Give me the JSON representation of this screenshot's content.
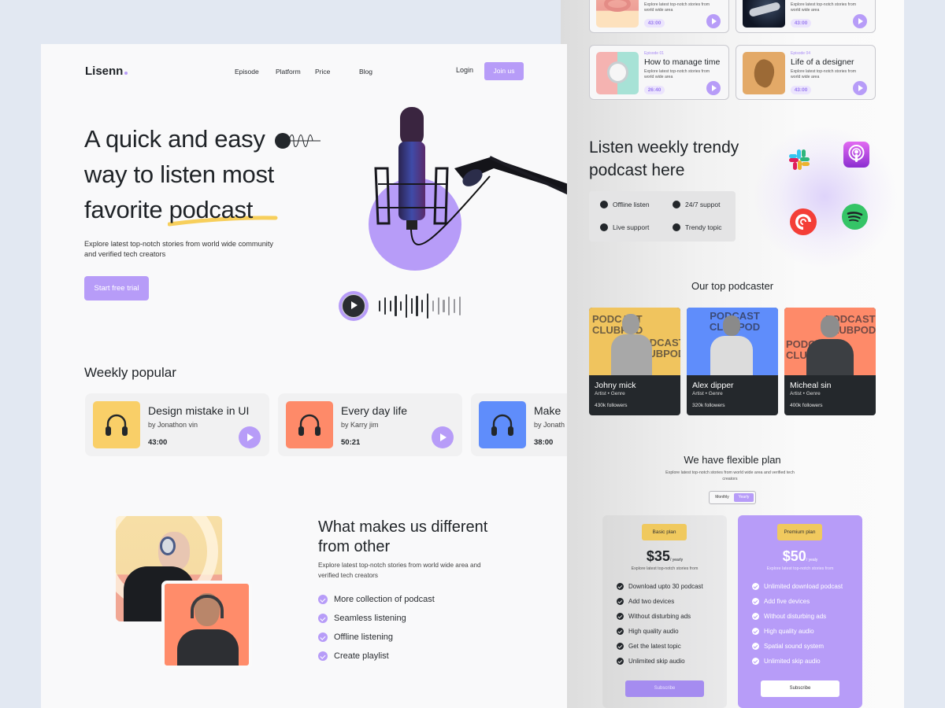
{
  "header": {
    "logo": "Lisenn",
    "nav": [
      "Episode",
      "Platform",
      "Price",
      "Blog"
    ],
    "login": "Login",
    "join": "Join us"
  },
  "hero": {
    "title_line1": "A quick and easy",
    "title_line2": "way to listen most",
    "title_line3_a": "favorite ",
    "title_line3_b": "podcast",
    "subtitle": "Explore latest top-notch stories from world wide community and verified tech creators",
    "cta": "Start free trial",
    "player": {
      "icon": "play-icon"
    }
  },
  "weekly": {
    "title": "Weekly popular",
    "items": [
      {
        "title": "Design mistake in UI",
        "author": "by Jonathon vin",
        "duration": "43:00",
        "color": "#f9cf68",
        "icon": "headphones-icon"
      },
      {
        "title": "Every day life",
        "author": "by Karry jim",
        "duration": "50:21",
        "color": "#fe8a69",
        "icon": "headphones-icon"
      },
      {
        "title": "Make",
        "author": "by Jonath",
        "duration": "38:00",
        "color": "#5f8dfb",
        "icon": "headphones-icon"
      }
    ]
  },
  "different": {
    "title": "What makes us different from other",
    "subtitle": "Explore latest top-notch stories from world wide area and verified tech creators",
    "features": [
      "More collection of podcast",
      "Seamless listening",
      "Offline listening",
      "Create playlist"
    ]
  },
  "episodes": [
    {
      "label": "",
      "title": "",
      "desc": "Explore latest top-notch stories from world wide area",
      "duration": "43:00"
    },
    {
      "label": "",
      "title": "",
      "desc": "Explore latest top-notch stories from world wide area",
      "duration": "43:00"
    },
    {
      "label": "Episode 01",
      "title": "How to manage time",
      "desc": "Explore latest top-notch stories from world wide area",
      "duration": "26:40"
    },
    {
      "label": "Episode 04",
      "title": "Life of a designer",
      "desc": "Explore latest top-notch stories from world wide area",
      "duration": "43:00"
    }
  ],
  "trendy": {
    "title": "Listen weekly trendy podcast here",
    "features": [
      "Offline listen",
      "24/7 suppot",
      "Live support",
      "Trendy topic"
    ],
    "apps": [
      "slack-icon",
      "apple-podcasts-icon",
      "pocket-casts-icon",
      "spotify-icon"
    ]
  },
  "podcasters": {
    "title": "Our top podcaster",
    "bg_text": "PODCAST CLUBPOD",
    "items": [
      {
        "name": "Johny mick",
        "meta": "Artist  •  Genre",
        "followers": "430k followers",
        "color": "#f0c45e"
      },
      {
        "name": "Alex dipper",
        "meta": "Artist  •  Genre",
        "followers": "320k followers",
        "color": "#5f8dfb"
      },
      {
        "name": "Micheal sin",
        "meta": "Artist  •  Genre",
        "followers": "400k followers",
        "color": "#fe8a69"
      }
    ]
  },
  "pricing": {
    "title": "We have flexible plan",
    "subtitle": "Explore latest top-notch stories from world wide area and verified tech creators",
    "toggle": {
      "monthly": "Monthly",
      "yearly": "Yearly",
      "selected": "Yearly"
    },
    "plans": [
      {
        "badge": "Basic plan",
        "price": "$35",
        "period": "/ yearly",
        "desc": "Explore latest top-notch stories from",
        "features": [
          "Download upto 30 podcast",
          "Add two devices",
          "Without disturbing ads",
          "High quality audio",
          "Get the latest topic",
          "Unlimited skip audio"
        ],
        "button": "Subscribe"
      },
      {
        "badge": "Premium plan",
        "price": "$50",
        "period": "/ yealy",
        "desc": "Explore latest top-notch stories from",
        "features": [
          "Unlimited download podcast",
          "Add five devices",
          "Without disturbing ads",
          "High quality audio",
          "Spatial sound system",
          "Unlimited skip audio"
        ],
        "button": "Subscribe"
      }
    ]
  },
  "colors": {
    "accent": "#b79cf8",
    "yellow": "#f0c95e",
    "dark": "#23272b",
    "background": "#e2e8f2"
  }
}
